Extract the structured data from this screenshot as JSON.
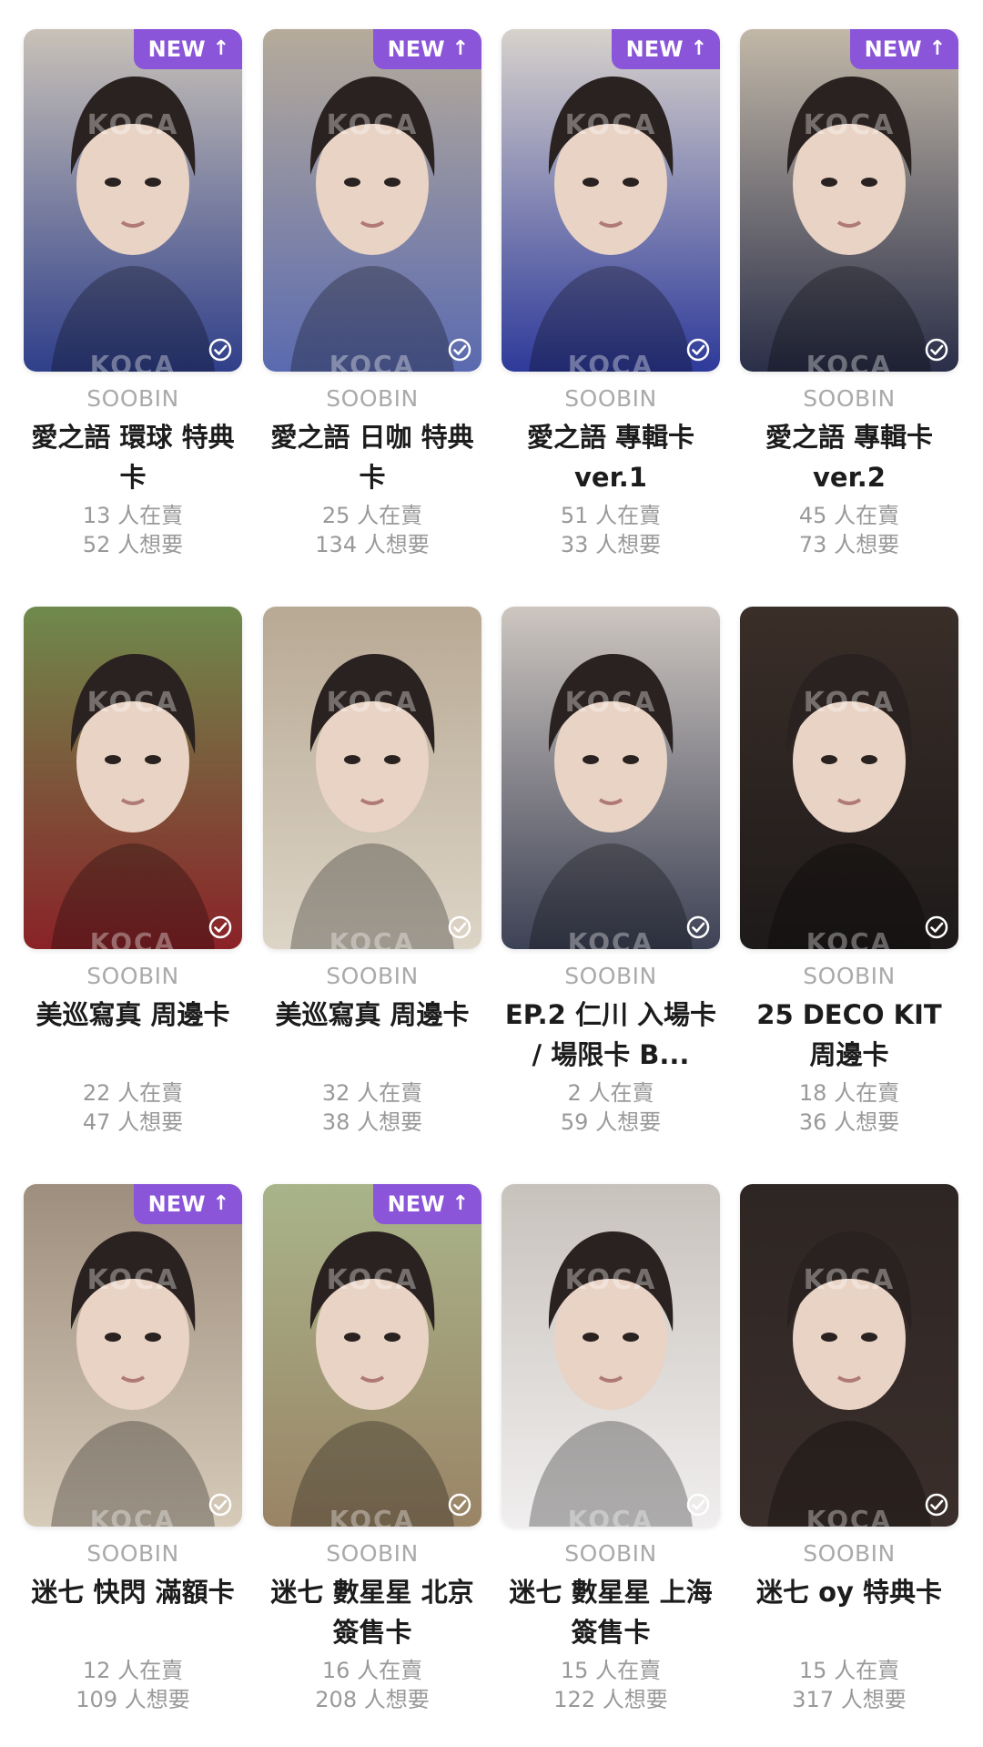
{
  "colors": {
    "accent": "#8a55d8",
    "title": "#1c1c1c",
    "muted": "#999999"
  },
  "watermark": "KOCA",
  "new_badge_label": "NEW",
  "cards": [
    {
      "artist": "SOOBIN",
      "title": "愛之語 環球 特典卡",
      "selling": "13 人在賣",
      "wanting": "52 人想要",
      "is_new": true,
      "bg": [
        "#c9c2b8",
        "#2f3f8a"
      ]
    },
    {
      "artist": "SOOBIN",
      "title": "愛之語 日咖 特典卡",
      "selling": "25 人在賣",
      "wanting": "134 人想要",
      "is_new": true,
      "bg": [
        "#b6ab9a",
        "#5a6ab0"
      ]
    },
    {
      "artist": "SOOBIN",
      "title": "愛之語 專輯卡 ver.1",
      "selling": "51 人在賣",
      "wanting": "33 人想要",
      "is_new": true,
      "bg": [
        "#d8d2cc",
        "#2e3a9a"
      ]
    },
    {
      "artist": "SOOBIN",
      "title": "愛之語 專輯卡 ver.2",
      "selling": "45 人在賣",
      "wanting": "73 人想要",
      "is_new": true,
      "bg": [
        "#c2b8a8",
        "#2a2e48"
      ]
    },
    {
      "artist": "SOOBIN",
      "title": "美巡寫真 周邊卡",
      "selling": "22 人在賣",
      "wanting": "47 人想要",
      "is_new": false,
      "bg": [
        "#6f8a4c",
        "#8a2228"
      ]
    },
    {
      "artist": "SOOBIN",
      "title": "美巡寫真 周邊卡",
      "selling": "32 人在賣",
      "wanting": "38 人想要",
      "is_new": false,
      "bg": [
        "#b8a994",
        "#dcd4c6"
      ]
    },
    {
      "artist": "SOOBIN",
      "title": "EP.2 仁川 入場卡 / 場限卡 B...",
      "selling": "2 人在賣",
      "wanting": "59 人想要",
      "is_new": false,
      "bg": [
        "#cdc6c0",
        "#3e4256"
      ]
    },
    {
      "artist": "SOOBIN",
      "title": "25 DECO KIT 周邊卡",
      "selling": "18 人在賣",
      "wanting": "36 人想要",
      "is_new": false,
      "bg": [
        "#3a2e28",
        "#1e1a1a"
      ]
    },
    {
      "artist": "SOOBIN",
      "title": "迷七 快閃 滿額卡",
      "selling": "12 人在賣",
      "wanting": "109 人想要",
      "is_new": true,
      "bg": [
        "#9e8e7e",
        "#d6cab8"
      ]
    },
    {
      "artist": "SOOBIN",
      "title": "迷七 數星星 北京 簽售卡",
      "selling": "16 人在賣",
      "wanting": "208 人想要",
      "is_new": true,
      "bg": [
        "#a9b48a",
        "#9a8466"
      ]
    },
    {
      "artist": "SOOBIN",
      "title": "迷七 數星星 上海 簽售卡",
      "selling": "15 人在賣",
      "wanting": "122 人想要",
      "is_new": false,
      "bg": [
        "#c8c2bc",
        "#f0eeee"
      ]
    },
    {
      "artist": "SOOBIN",
      "title": "迷七 oy 特典卡",
      "selling": "15 人在賣",
      "wanting": "317 人想要",
      "is_new": false,
      "bg": [
        "#2e2624",
        "#3a2e2a"
      ]
    }
  ]
}
